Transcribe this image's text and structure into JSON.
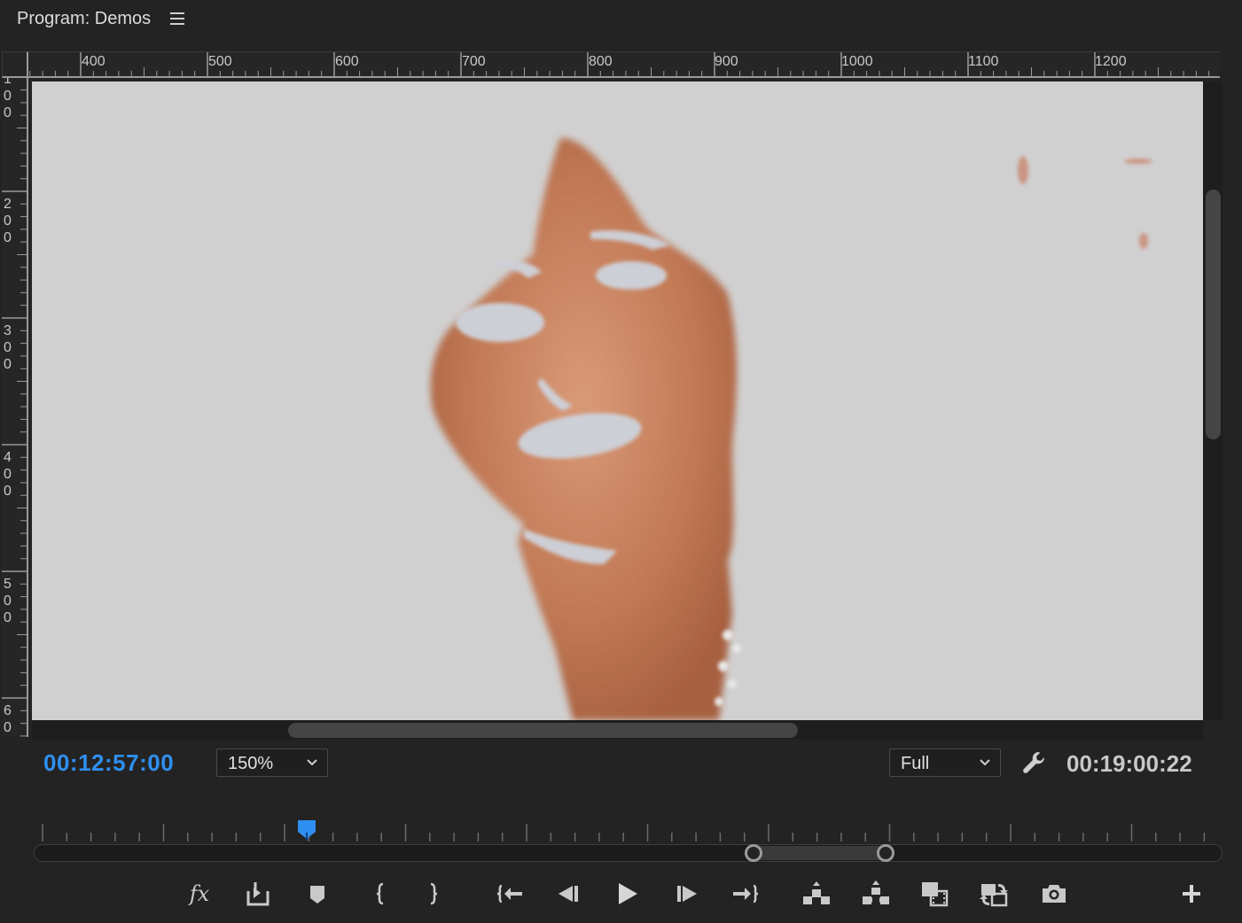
{
  "panel": {
    "title": "Program: Demos",
    "menu_icon": "hamburger-menu-icon"
  },
  "rulers": {
    "horizontal_labels": [
      "400",
      "500",
      "600",
      "700",
      "800",
      "900",
      "1000",
      "1100",
      "1200"
    ],
    "vertical_labels": [
      "1\n0\n0",
      "2\n0\n0",
      "3\n0\n0",
      "4\n0\n0",
      "5\n0\n0",
      "6\n0"
    ]
  },
  "viewer": {
    "background_color": "#d0d0d0",
    "content": "video-frame"
  },
  "playback": {
    "current_timecode": "00:12:57:00",
    "zoom_level": "150%",
    "resolution": "Full",
    "duration_timecode": "00:19:00:22",
    "accent_color": "#2f8ff0"
  },
  "transport": {
    "fx_label": "fx",
    "buttons": [
      {
        "name": "effects-fx-button",
        "icon": "fx-icon"
      },
      {
        "name": "export-frame-lift-button",
        "icon": "export-icon"
      },
      {
        "name": "add-marker-button",
        "icon": "marker-icon"
      },
      {
        "name": "mark-in-button",
        "icon": "mark-in-icon"
      },
      {
        "name": "mark-out-button",
        "icon": "mark-out-icon"
      },
      {
        "name": "go-to-in-button",
        "icon": "go-to-in-icon"
      },
      {
        "name": "step-back-button",
        "icon": "step-back-icon"
      },
      {
        "name": "play-button",
        "icon": "play-icon"
      },
      {
        "name": "step-forward-button",
        "icon": "step-forward-icon"
      },
      {
        "name": "go-to-out-button",
        "icon": "go-to-out-icon"
      },
      {
        "name": "lift-button",
        "icon": "lift-icon"
      },
      {
        "name": "extract-button",
        "icon": "extract-icon"
      },
      {
        "name": "comparison-view-button",
        "icon": "comparison-view-icon"
      },
      {
        "name": "toggle-proxies-button",
        "icon": "proxy-toggle-icon"
      },
      {
        "name": "export-frame-button",
        "icon": "camera-icon"
      },
      {
        "name": "button-editor-button",
        "icon": "plus-icon"
      }
    ]
  }
}
